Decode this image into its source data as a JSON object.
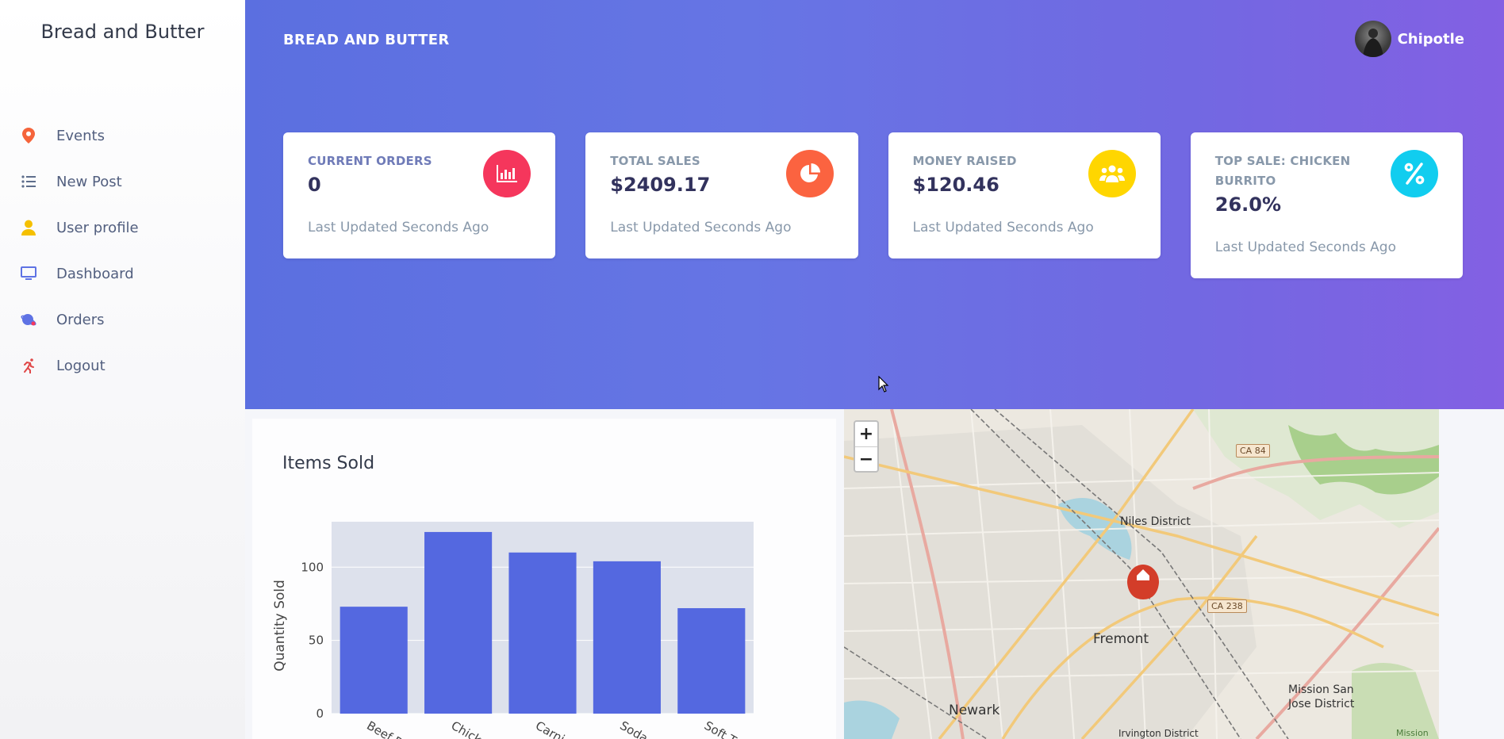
{
  "sidebar": {
    "brand": "Bread and Butter",
    "items": [
      {
        "label": "Events",
        "icon": "map-pin-icon",
        "color": "#f5643b"
      },
      {
        "label": "New Post",
        "icon": "list-icon",
        "color": "#5e6e8c"
      },
      {
        "label": "User profile",
        "icon": "user-icon",
        "color": "#f5c000"
      },
      {
        "label": "Dashboard",
        "icon": "monitor-icon",
        "color": "#5e72e4"
      },
      {
        "label": "Orders",
        "icon": "planet-icon",
        "color": "#5e72e4"
      },
      {
        "label": "Logout",
        "icon": "running-icon",
        "color": "#e04848"
      }
    ]
  },
  "header": {
    "title": "BREAD AND BUTTER",
    "user": "Chipotle"
  },
  "cards": [
    {
      "label": "CURRENT ORDERS",
      "value": "0",
      "foot": "Last Updated Seconds Ago",
      "icon": "bar-chart-icon",
      "color": "#f5365c"
    },
    {
      "label": "TOTAL SALES",
      "value": "$2409.17",
      "foot": "Last Updated Seconds Ago",
      "icon": "pie-chart-icon",
      "color": "#fb6340"
    },
    {
      "label": "MONEY RAISED",
      "value": "$120.46",
      "foot": "Last Updated Seconds Ago",
      "icon": "users-icon",
      "color": "#ffd600"
    },
    {
      "label": "TOP SALE: CHICKEN BURRITO",
      "value": "26.0%",
      "foot": "Last Updated Seconds Ago",
      "icon": "percent-icon",
      "color": "#11cdef"
    }
  ],
  "chart": {
    "title": "Items Sold"
  },
  "chart_data": {
    "type": "bar",
    "title": "Items Sold",
    "categories": [
      "Beef B",
      "Chick",
      "Carni",
      "Soda",
      "Soft T"
    ],
    "values": [
      73,
      124,
      110,
      104,
      72
    ],
    "xlabel": "",
    "ylabel": "Quantity Sold",
    "ylim": [
      0,
      131
    ],
    "yticks": [
      0,
      50,
      100
    ],
    "grid": true,
    "color": "#5468e0"
  },
  "map": {
    "zoom_in": "+",
    "zoom_out": "−",
    "labels": {
      "niles": "Niles District",
      "fremont": "Fremont",
      "newark": "Newark",
      "mission": "Mission San",
      "mission2": "Jose District",
      "irvington": "Irvington District",
      "mission_small": "Mission"
    },
    "badges": {
      "ca84": "CA 84",
      "ca238": "CA 238"
    }
  }
}
